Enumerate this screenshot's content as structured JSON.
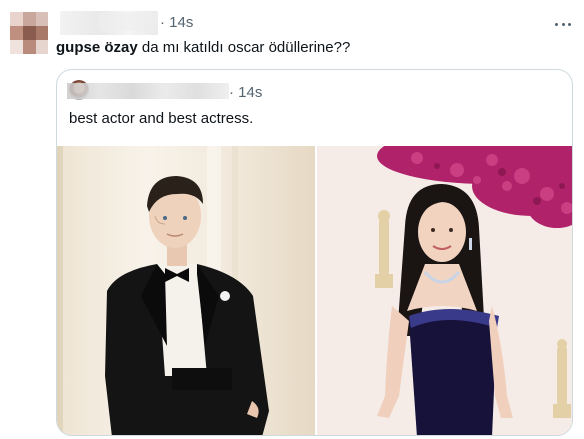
{
  "tweet": {
    "timestamp": "· 14s",
    "mention": "gupse özay",
    "text_rest": " da mı katıldı oscar ödüllerine??"
  },
  "quote": {
    "timestamp": "· 14s",
    "text": "best actor and best actress."
  },
  "colors": {
    "text_primary": "#0f1419",
    "text_secondary": "#536471",
    "border": "#cfd9de",
    "flowers": "#b0226a"
  }
}
